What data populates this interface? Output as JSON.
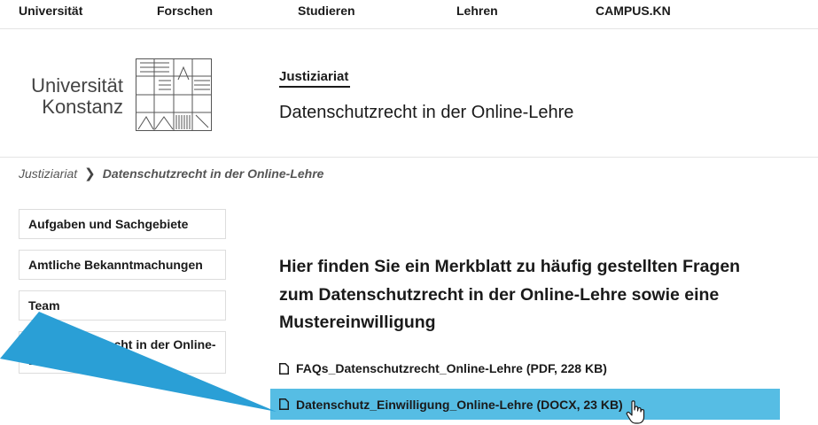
{
  "topnav": {
    "items": [
      "Universität",
      "Forschen",
      "Studieren",
      "Lehren",
      "CAMPUS.KN"
    ]
  },
  "logo": {
    "line1": "Universität",
    "line2": "Konstanz"
  },
  "header": {
    "section": "Justiziariat",
    "title": "Datenschutzrecht in der Online-Lehre"
  },
  "breadcrumb": {
    "parent": "Justiziariat",
    "current": "Datenschutzrecht in der Online-Lehre"
  },
  "sidebar": {
    "items": [
      {
        "label": "Aufgaben und Sachgebiete"
      },
      {
        "label": "Amtliche Bekanntmachungen"
      },
      {
        "label": "Team"
      },
      {
        "label": "Datenschutzrecht in der Online-Lehre"
      }
    ]
  },
  "main": {
    "heading": "Hier finden Sie ein Merkblatt zu häufig gestellten Fragen zum Datenschutzrecht in der Online-Lehre sowie eine Mustereinwilligung",
    "files": [
      {
        "label": "FAQs_Datenschutzrecht_Online-Lehre (PDF, 228 KB)"
      },
      {
        "label": "Datenschutz_Einwilligung_Online-Lehre (DOCX, 23 KB)"
      }
    ]
  },
  "colors": {
    "highlight": "#56bde4",
    "annotation_arrow": "#2a9fd6"
  },
  "icons": [
    "document-icon",
    "hand-pointer-icon",
    "annotation-arrow"
  ]
}
